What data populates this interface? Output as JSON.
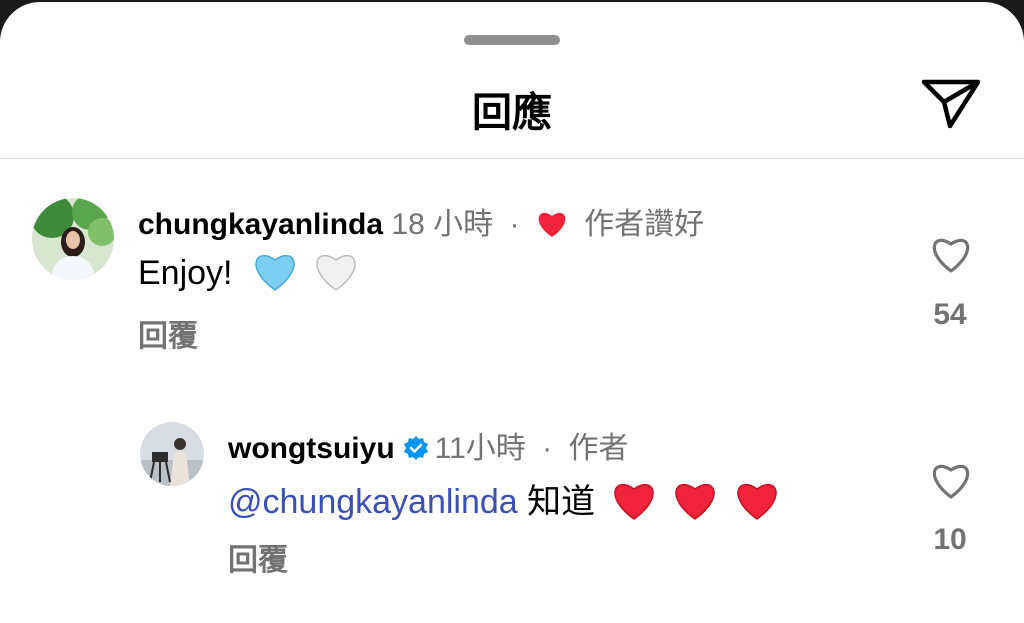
{
  "header": {
    "title": "回應",
    "send_icon": "send-icon"
  },
  "comment": {
    "username": "chungkayanlinda",
    "time": "18 小時",
    "separator": "·",
    "liked_by_author": "作者讚好",
    "text": "Enjoy!",
    "emojis": [
      "light-blue-heart",
      "white-heart"
    ],
    "reply_label": "回覆",
    "like_count": "54"
  },
  "reply": {
    "username": "wongtsuiyu",
    "verified": true,
    "time": "11小時",
    "separator": "·",
    "author_badge": "作者",
    "mention": "@chungkayanlinda",
    "text": " 知道",
    "emojis": [
      "red-heart",
      "red-heart",
      "red-heart"
    ],
    "reply_label": "回覆",
    "like_count": "10"
  },
  "colors": {
    "red_heart": "#f0233a",
    "light_blue_heart": "#7ccef2",
    "white_heart": "#f2f2f2",
    "mention": "#3b4fb8",
    "verified": "#0095f6",
    "secondary_text": "#737373"
  }
}
